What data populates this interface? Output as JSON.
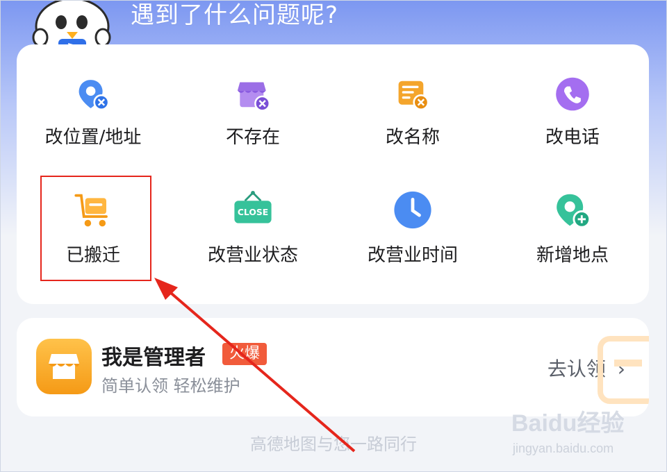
{
  "header": {
    "title": "遇到了什么问题呢?"
  },
  "issues": [
    {
      "label": "改位置/地址",
      "icon": "location-remove-icon"
    },
    {
      "label": "不存在",
      "icon": "store-remove-icon"
    },
    {
      "label": "改名称",
      "icon": "document-edit-icon"
    },
    {
      "label": "改电话",
      "icon": "phone-icon"
    },
    {
      "label": "已搬迁",
      "icon": "moving-cart-icon"
    },
    {
      "label": "改营业状态",
      "icon": "closed-sign-icon",
      "sign_text": "CLOSE"
    },
    {
      "label": "改营业时间",
      "icon": "clock-icon"
    },
    {
      "label": "新增地点",
      "icon": "location-add-icon"
    }
  ],
  "manager": {
    "title": "我是管理者",
    "badge": "火爆",
    "subtitle": "简单认领 轻松维护",
    "action": "去认领",
    "icon": "shop-icon"
  },
  "footer": {
    "text": "高德地图与您一路同行"
  },
  "watermark": {
    "brand": "Baidu经验",
    "url": "jingyan.baidu.com"
  },
  "colors": {
    "highlight": "#e5261c",
    "accent_blue": "#3b82f6",
    "badge": "#f15b3b"
  }
}
